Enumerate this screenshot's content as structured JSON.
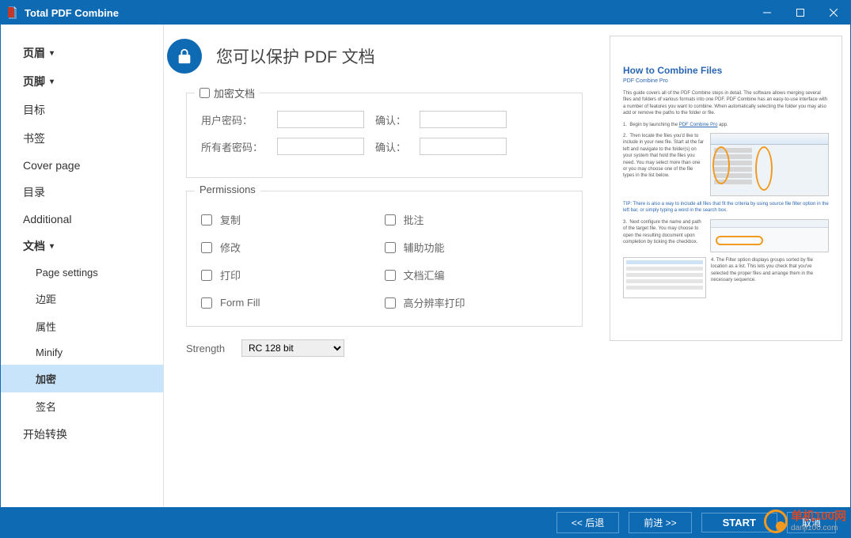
{
  "window": {
    "title": "Total PDF Combine"
  },
  "sidebar": {
    "items": [
      {
        "label": "页眉",
        "bold": true,
        "caret": true
      },
      {
        "label": "页脚",
        "bold": true,
        "caret": true
      },
      {
        "label": "目标"
      },
      {
        "label": "书签"
      },
      {
        "label": "Cover page"
      },
      {
        "label": "目录"
      },
      {
        "label": "Additional"
      },
      {
        "label": "文档",
        "bold": true,
        "caret": true
      },
      {
        "label": "Page settings",
        "sub": true
      },
      {
        "label": "边距",
        "sub": true
      },
      {
        "label": "属性",
        "sub": true
      },
      {
        "label": "Minify",
        "sub": true
      },
      {
        "label": "加密",
        "sub": true,
        "selected": true
      },
      {
        "label": "签名",
        "sub": true
      },
      {
        "label": "开始转换"
      }
    ]
  },
  "header": {
    "title": "您可以保护 PDF 文档"
  },
  "encrypt": {
    "legend": "加密文档",
    "userpw_label": "用户密码：",
    "ownerpw_label": "所有者密码：",
    "confirm_label": "确认：",
    "userpw": "",
    "userpw_confirm": "",
    "ownerpw": "",
    "ownerpw_confirm": ""
  },
  "permissions": {
    "legend": "Permissions",
    "items": [
      {
        "label": "复制"
      },
      {
        "label": "批注"
      },
      {
        "label": "修改"
      },
      {
        "label": "辅助功能"
      },
      {
        "label": "打印"
      },
      {
        "label": "文档汇编"
      },
      {
        "label": "Form Fill"
      },
      {
        "label": "高分辨率打印"
      }
    ]
  },
  "strength": {
    "label": "Strength",
    "value": "RC 128 bit"
  },
  "preview": {
    "title": "How to Combine Files",
    "sub": "PDF Combine Pro"
  },
  "footer": {
    "back": "<<  后退",
    "next": "前进  >>",
    "start": "START",
    "cancel": "取消"
  },
  "watermark": {
    "cn": "单机100网",
    "url": "danji100.com"
  }
}
